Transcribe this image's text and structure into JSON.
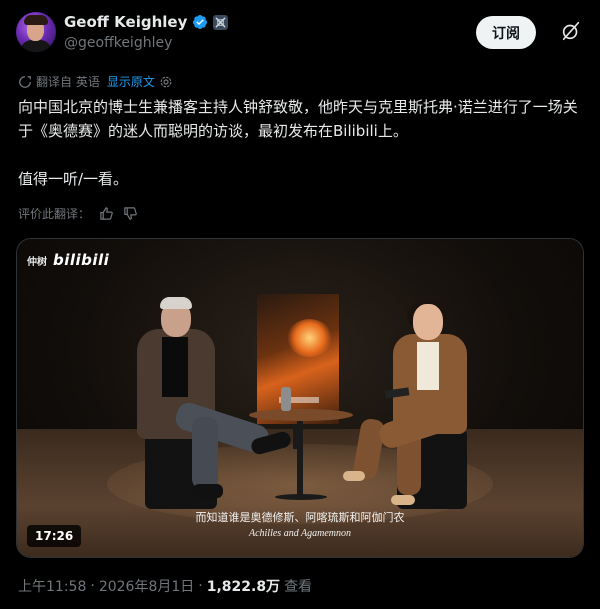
{
  "author": {
    "display_name": "Geoff Keighley",
    "handle": "@geoffkeighley",
    "avatar_icon": "avatar-photo",
    "verified_icon": "verified-badge-icon",
    "affiliate_icon": "affiliate-badge-icon",
    "brand_color": "#1d9bf0"
  },
  "header": {
    "subscribe_label": "订阅",
    "grok_icon": "grok-icon"
  },
  "translation": {
    "label": "翻译自 英语",
    "show_original": "显示原文",
    "icon": "translate-icon",
    "settings_icon": "gear-icon"
  },
  "tweet": {
    "line1": "向中国北京的博士生兼播客主持人钟舒致敬，他昨天与克里斯托弗·诺兰进行了一场关于《奥德赛》的迷人而聪明的访谈，最初发布在Bilibili上。",
    "line2": "值得一听/一看。"
  },
  "rate": {
    "label": "评价此翻译：",
    "thumbs_up_icon": "thumbs-up-icon",
    "thumbs_down_icon": "thumbs-down-icon"
  },
  "media": {
    "watermark_prefix": "仲树",
    "watermark_logo": "bilibili",
    "subtitle_cn": "而知道谁是奥德修斯、阿喀琉斯和阿伽门农",
    "subtitle_en": "Achilles and Agamemnon",
    "duration": "17:26"
  },
  "meta": {
    "time": "上午11:58",
    "separator": "·",
    "date": "2026年8月1日",
    "views": "1,822.8万",
    "views_label": "查看"
  }
}
